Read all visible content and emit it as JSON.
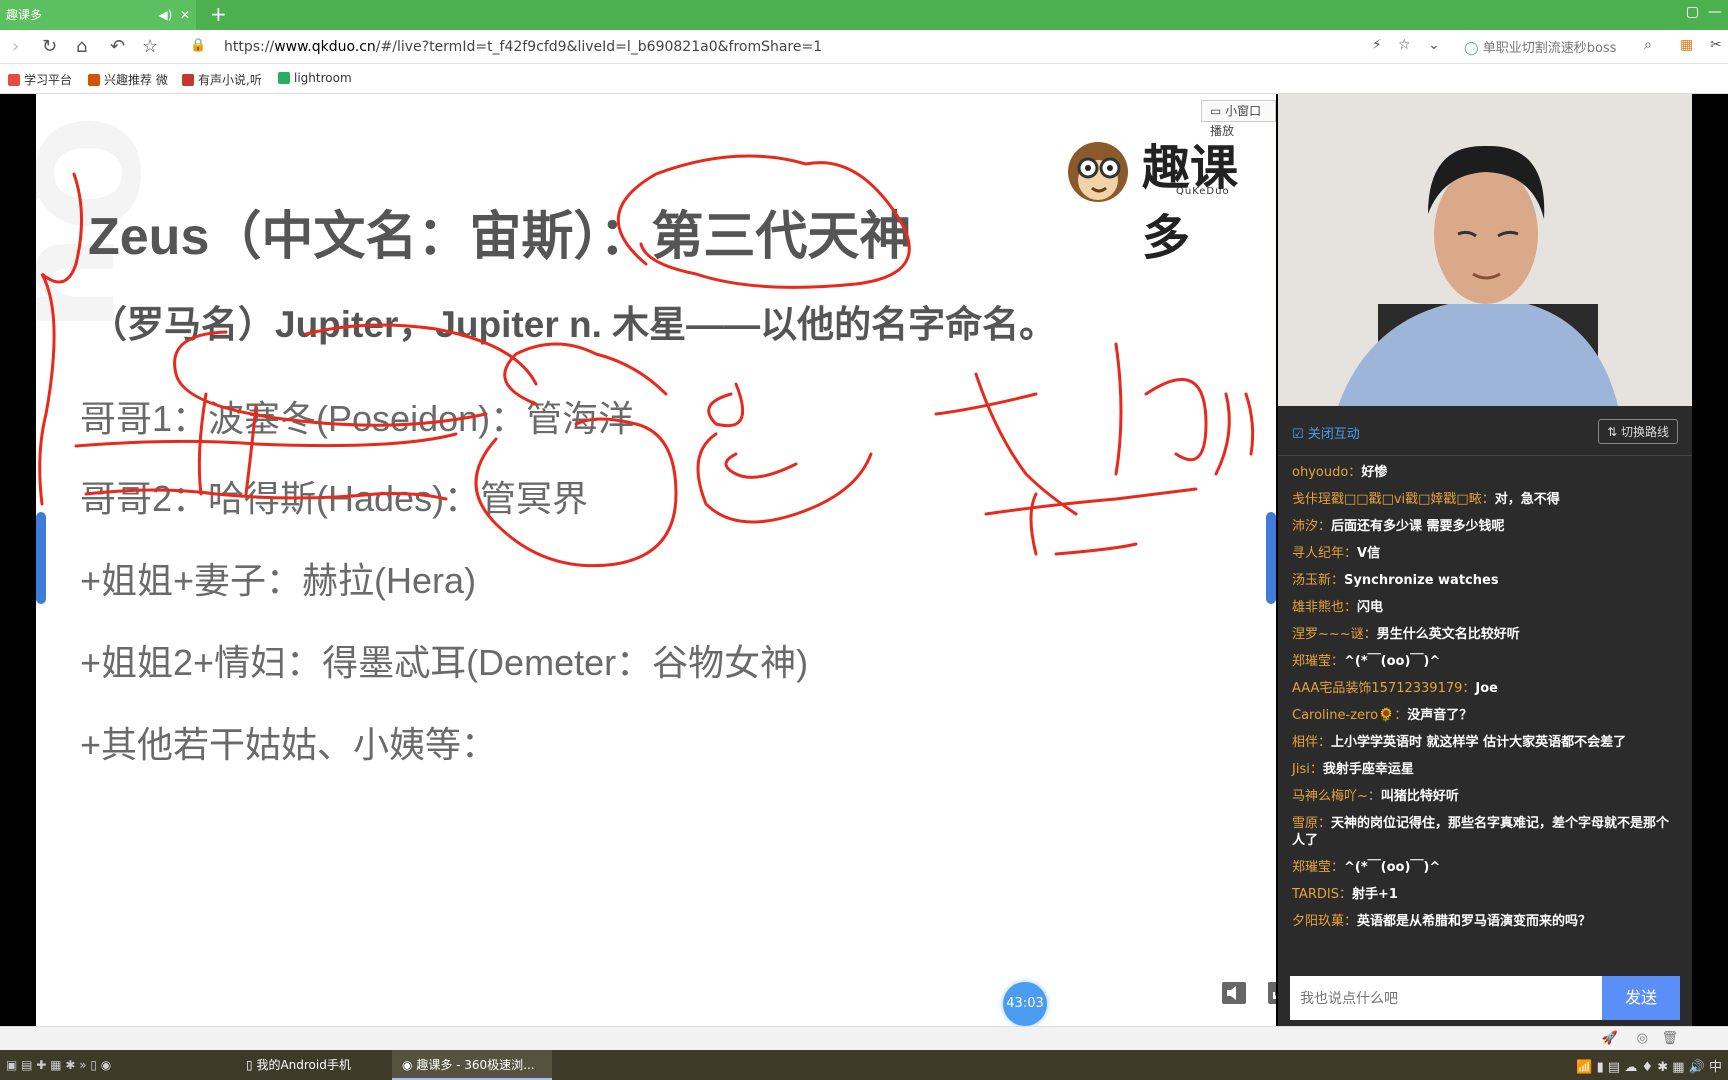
{
  "browser": {
    "tab_title": "趣课多",
    "url_prefix": "https://",
    "url_domain": "www.qkduo.cn",
    "url_rest": "/#/live?termId=t_f42f9cfd9&liveId=l_b690821a0&fromShare=1",
    "search_text": "单职业切割流速秒boss"
  },
  "bookmarks": [
    {
      "label": "学习平台",
      "color": "#e74c3c"
    },
    {
      "label": "兴趣推荐 微",
      "color": "#d35400"
    },
    {
      "label": "有声小说,听",
      "color": "#c0392b"
    },
    {
      "label": "lightroom",
      "color": "#27ae60"
    }
  ],
  "player": {
    "mini_window_label": "小窗口播放",
    "timer": "43:03"
  },
  "logo": {
    "text": "趣课多",
    "sub": "QuKeDuo"
  },
  "slide": {
    "title": "Zeus（中文名：宙斯）：第三代天神",
    "subtitle": "（罗马名）Jupiter，Jupiter n. 木星——以他的名字命名。",
    "lines": [
      "哥哥1：波塞冬(Poseidon)：管海洋",
      "哥哥2：哈得斯(Hades)：管冥界",
      "+姐姐+妻子：赫拉(Hera)",
      "+姐姐2+情妇：得墨忒耳(Demeter：谷物女神)",
      "+其他若干姑姑、小姨等："
    ]
  },
  "chat": {
    "close_interact": "关闭互动",
    "switch_route": "切换路线",
    "messages": [
      {
        "nick": "ohyoudo",
        "text": "好惨"
      },
      {
        "nick": "戋佧珵戳□□戳□vi戳□婞戳□畩",
        "text": "对，急不得"
      },
      {
        "nick": "沛汐",
        "text": "后面还有多少课 需要多少钱呢"
      },
      {
        "nick": "寻人纪年",
        "text": "V信"
      },
      {
        "nick": "汤玉新",
        "text": "Synchronize watches"
      },
      {
        "nick": "雄非熊也",
        "text": "闪电"
      },
      {
        "nick": "涅罗~~~谜",
        "text": "男生什么英文名比较好听"
      },
      {
        "nick": "郑璀莹",
        "text": "^(*￣(oo)￣)^"
      },
      {
        "nick": "AAA宅品装饰15712339179",
        "text": "Joe"
      },
      {
        "nick": "Caroline-zero🌻",
        "text": "没声音了？"
      },
      {
        "nick": "相伴",
        "text": "上小学学英语时 就这样学 估计大家英语都不会差了"
      },
      {
        "nick": "Jisi",
        "text": "我射手座幸运星"
      },
      {
        "nick": "马神么梅吖~",
        "text": "叫猪比特好听"
      },
      {
        "nick": "雪原",
        "text": "天神的岗位记得住，那些名字真难记，差个字母就不是那个人了"
      },
      {
        "nick": "郑璀莹",
        "text": "^(*￣(oo)￣)^"
      },
      {
        "nick": "TARDIS",
        "text": "射手+1"
      },
      {
        "nick": "夕阳玖菓",
        "text": "英语都是从希腊和罗马语演变而来的吗？"
      }
    ],
    "input_placeholder": "我也说点什么吧",
    "send_label": "发送"
  },
  "taskbar": {
    "item1": "我的Android手机",
    "item2": "趣课多 - 360极速浏..."
  },
  "colors": {
    "ink": "#e8291c",
    "nick": "#e6a23c",
    "accent": "#5b8ef7",
    "tab_green": "#4caf50"
  }
}
